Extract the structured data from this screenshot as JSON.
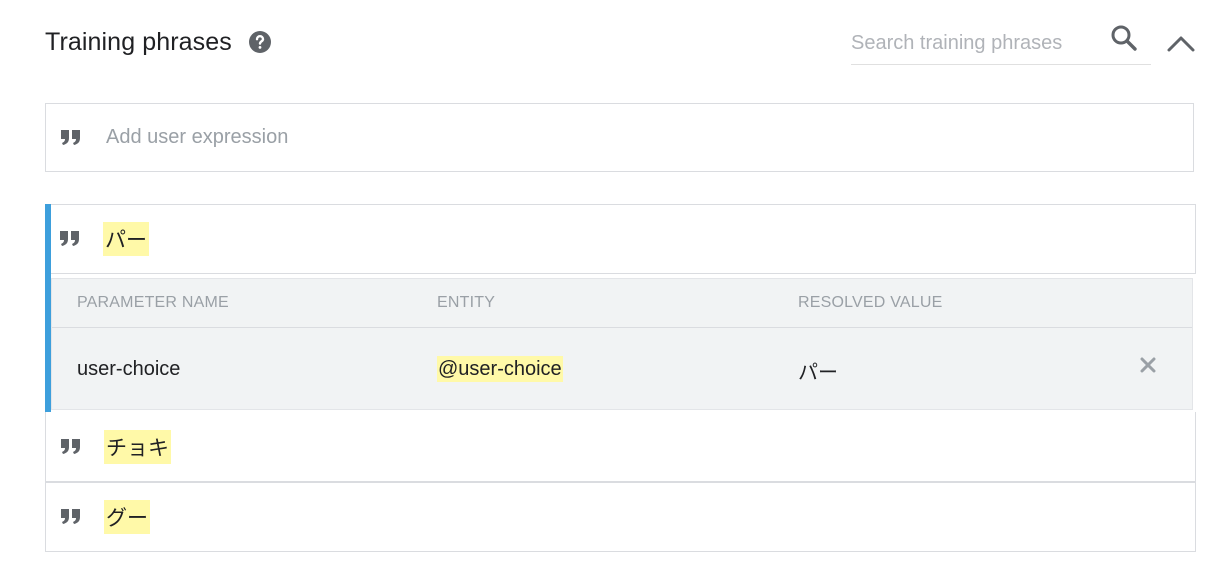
{
  "header": {
    "title": "Training phrases",
    "help_icon": "help-circle-icon"
  },
  "search": {
    "placeholder": "Search training phrases",
    "value": "",
    "icon": "search-icon"
  },
  "collapse": {
    "icon": "chevron-up-icon"
  },
  "add_expression": {
    "placeholder": "Add user expression",
    "value": "",
    "icon": "quote-icon"
  },
  "phrases": [
    {
      "text": "パー",
      "expanded": true
    },
    {
      "text": "チョキ",
      "expanded": false
    },
    {
      "text": "グー",
      "expanded": false
    }
  ],
  "parameters": {
    "columns": [
      "PARAMETER NAME",
      "ENTITY",
      "RESOLVED VALUE"
    ],
    "rows": [
      {
        "name": "user-choice",
        "entity": "@user-choice",
        "resolved_value": "パー"
      }
    ]
  },
  "colors": {
    "highlight": "#fff9a8",
    "active_accent": "#3d9fdc",
    "border": "#dadce0",
    "panel_bg": "#f1f3f4"
  }
}
